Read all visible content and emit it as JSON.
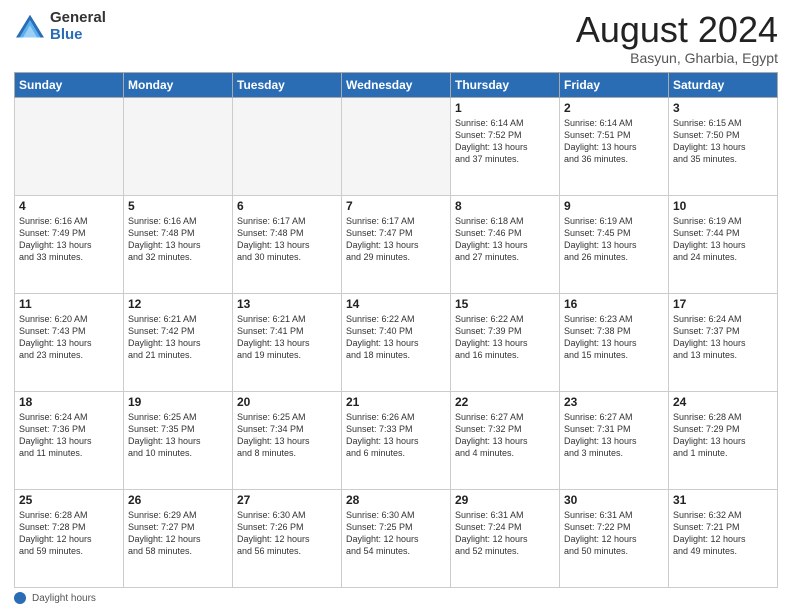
{
  "header": {
    "logo_general": "General",
    "logo_blue": "Blue",
    "main_title": "August 2024",
    "subtitle": "Basyun, Gharbia, Egypt"
  },
  "calendar": {
    "days_of_week": [
      "Sunday",
      "Monday",
      "Tuesday",
      "Wednesday",
      "Thursday",
      "Friday",
      "Saturday"
    ],
    "weeks": [
      [
        {
          "day": "",
          "info": ""
        },
        {
          "day": "",
          "info": ""
        },
        {
          "day": "",
          "info": ""
        },
        {
          "day": "",
          "info": ""
        },
        {
          "day": "1",
          "info": "Sunrise: 6:14 AM\nSunset: 7:52 PM\nDaylight: 13 hours\nand 37 minutes."
        },
        {
          "day": "2",
          "info": "Sunrise: 6:14 AM\nSunset: 7:51 PM\nDaylight: 13 hours\nand 36 minutes."
        },
        {
          "day": "3",
          "info": "Sunrise: 6:15 AM\nSunset: 7:50 PM\nDaylight: 13 hours\nand 35 minutes."
        }
      ],
      [
        {
          "day": "4",
          "info": "Sunrise: 6:16 AM\nSunset: 7:49 PM\nDaylight: 13 hours\nand 33 minutes."
        },
        {
          "day": "5",
          "info": "Sunrise: 6:16 AM\nSunset: 7:48 PM\nDaylight: 13 hours\nand 32 minutes."
        },
        {
          "day": "6",
          "info": "Sunrise: 6:17 AM\nSunset: 7:48 PM\nDaylight: 13 hours\nand 30 minutes."
        },
        {
          "day": "7",
          "info": "Sunrise: 6:17 AM\nSunset: 7:47 PM\nDaylight: 13 hours\nand 29 minutes."
        },
        {
          "day": "8",
          "info": "Sunrise: 6:18 AM\nSunset: 7:46 PM\nDaylight: 13 hours\nand 27 minutes."
        },
        {
          "day": "9",
          "info": "Sunrise: 6:19 AM\nSunset: 7:45 PM\nDaylight: 13 hours\nand 26 minutes."
        },
        {
          "day": "10",
          "info": "Sunrise: 6:19 AM\nSunset: 7:44 PM\nDaylight: 13 hours\nand 24 minutes."
        }
      ],
      [
        {
          "day": "11",
          "info": "Sunrise: 6:20 AM\nSunset: 7:43 PM\nDaylight: 13 hours\nand 23 minutes."
        },
        {
          "day": "12",
          "info": "Sunrise: 6:21 AM\nSunset: 7:42 PM\nDaylight: 13 hours\nand 21 minutes."
        },
        {
          "day": "13",
          "info": "Sunrise: 6:21 AM\nSunset: 7:41 PM\nDaylight: 13 hours\nand 19 minutes."
        },
        {
          "day": "14",
          "info": "Sunrise: 6:22 AM\nSunset: 7:40 PM\nDaylight: 13 hours\nand 18 minutes."
        },
        {
          "day": "15",
          "info": "Sunrise: 6:22 AM\nSunset: 7:39 PM\nDaylight: 13 hours\nand 16 minutes."
        },
        {
          "day": "16",
          "info": "Sunrise: 6:23 AM\nSunset: 7:38 PM\nDaylight: 13 hours\nand 15 minutes."
        },
        {
          "day": "17",
          "info": "Sunrise: 6:24 AM\nSunset: 7:37 PM\nDaylight: 13 hours\nand 13 minutes."
        }
      ],
      [
        {
          "day": "18",
          "info": "Sunrise: 6:24 AM\nSunset: 7:36 PM\nDaylight: 13 hours\nand 11 minutes."
        },
        {
          "day": "19",
          "info": "Sunrise: 6:25 AM\nSunset: 7:35 PM\nDaylight: 13 hours\nand 10 minutes."
        },
        {
          "day": "20",
          "info": "Sunrise: 6:25 AM\nSunset: 7:34 PM\nDaylight: 13 hours\nand 8 minutes."
        },
        {
          "day": "21",
          "info": "Sunrise: 6:26 AM\nSunset: 7:33 PM\nDaylight: 13 hours\nand 6 minutes."
        },
        {
          "day": "22",
          "info": "Sunrise: 6:27 AM\nSunset: 7:32 PM\nDaylight: 13 hours\nand 4 minutes."
        },
        {
          "day": "23",
          "info": "Sunrise: 6:27 AM\nSunset: 7:31 PM\nDaylight: 13 hours\nand 3 minutes."
        },
        {
          "day": "24",
          "info": "Sunrise: 6:28 AM\nSunset: 7:29 PM\nDaylight: 13 hours\nand 1 minute."
        }
      ],
      [
        {
          "day": "25",
          "info": "Sunrise: 6:28 AM\nSunset: 7:28 PM\nDaylight: 12 hours\nand 59 minutes."
        },
        {
          "day": "26",
          "info": "Sunrise: 6:29 AM\nSunset: 7:27 PM\nDaylight: 12 hours\nand 58 minutes."
        },
        {
          "day": "27",
          "info": "Sunrise: 6:30 AM\nSunset: 7:26 PM\nDaylight: 12 hours\nand 56 minutes."
        },
        {
          "day": "28",
          "info": "Sunrise: 6:30 AM\nSunset: 7:25 PM\nDaylight: 12 hours\nand 54 minutes."
        },
        {
          "day": "29",
          "info": "Sunrise: 6:31 AM\nSunset: 7:24 PM\nDaylight: 12 hours\nand 52 minutes."
        },
        {
          "day": "30",
          "info": "Sunrise: 6:31 AM\nSunset: 7:22 PM\nDaylight: 12 hours\nand 50 minutes."
        },
        {
          "day": "31",
          "info": "Sunrise: 6:32 AM\nSunset: 7:21 PM\nDaylight: 12 hours\nand 49 minutes."
        }
      ]
    ]
  },
  "footer": {
    "daylight_hours_label": "Daylight hours"
  }
}
